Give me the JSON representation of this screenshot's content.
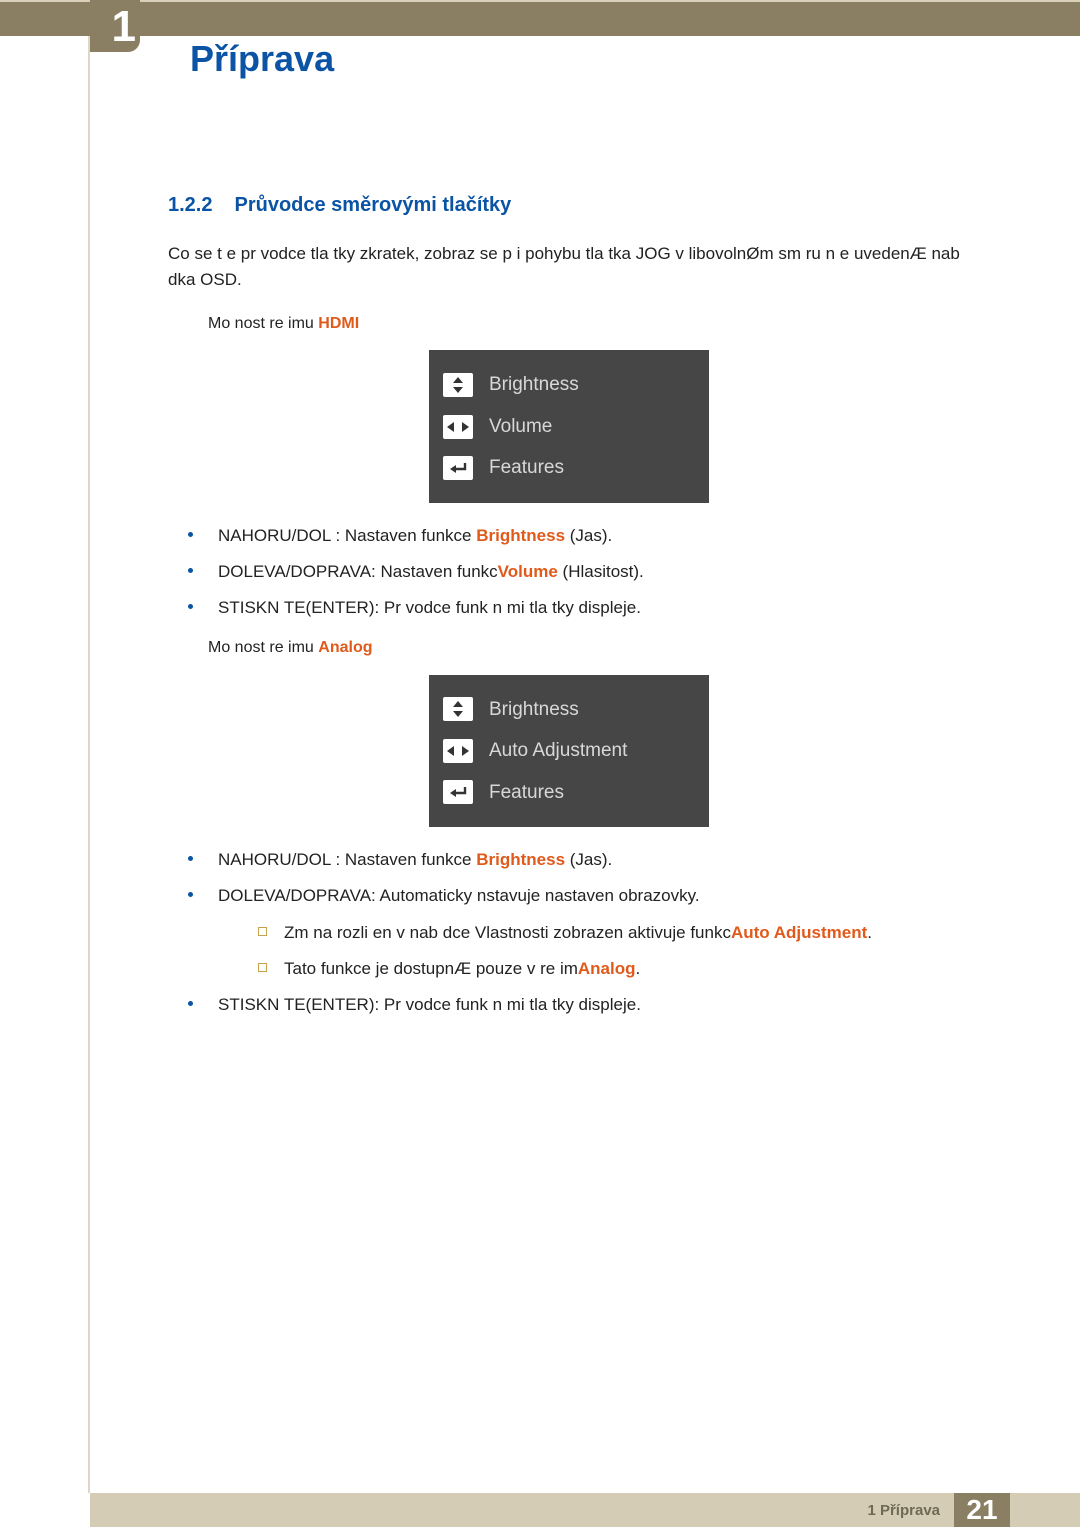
{
  "header": {
    "chapter_number": "1",
    "chapter_title": "Příprava"
  },
  "section": {
    "num": "1.2.2",
    "title": "Průvodce směrovými tlačítky"
  },
  "intro": "Co se t e pr vodce tla tky zkratek, zobraz se p i pohybu tla tka JOG v libovolnØm sm ru n e uvedenÆ nab dka OSD.",
  "hdmi": {
    "mode_prefix": "Mo nost re imu ",
    "mode": "HDMI",
    "osd": {
      "row1": "Brightness",
      "row2": "Volume",
      "row3": "Features"
    },
    "b1_pre": "NAHORU/DOL : Nastaven  funkce ",
    "b1_hl": "Brightness",
    "b1_post": " (Jas).",
    "b2_pre": "DOLEVA/DOPRAVA: Nastaven  funkc",
    "b2_hl": "Volume",
    "b2_post": " (Hlasitost).",
    "b3": "STISKN TE(ENTER): Pr vodce funk n mi tla tky displeje."
  },
  "analog": {
    "mode_prefix": "Mo nost re imu ",
    "mode": "Analog",
    "osd": {
      "row1": "Brightness",
      "row2": "Auto Adjustment",
      "row3": "Features"
    },
    "b1_pre": "NAHORU/DOL : Nastaven  funkce ",
    "b1_hl": "Brightness",
    "b1_post": " (Jas).",
    "b2": "DOLEVA/DOPRAVA: Automaticky nstavuje nastaven  obrazovky.",
    "s1_pre": "Zm na rozli en  v nab dce Vlastnosti zobrazen  aktivuje funkc",
    "s1_hl": "Auto Adjustment",
    "s1_post": ".",
    "s2_pre": "Tato funkce je dostupnÆ pouze v re im",
    "s2_hl": "Analog",
    "s2_post": ".",
    "b3": "STISKN TE(ENTER): Pr vodce funk n mi tla tky displeje."
  },
  "footer": {
    "label": "1 Příprava",
    "page": "21"
  }
}
